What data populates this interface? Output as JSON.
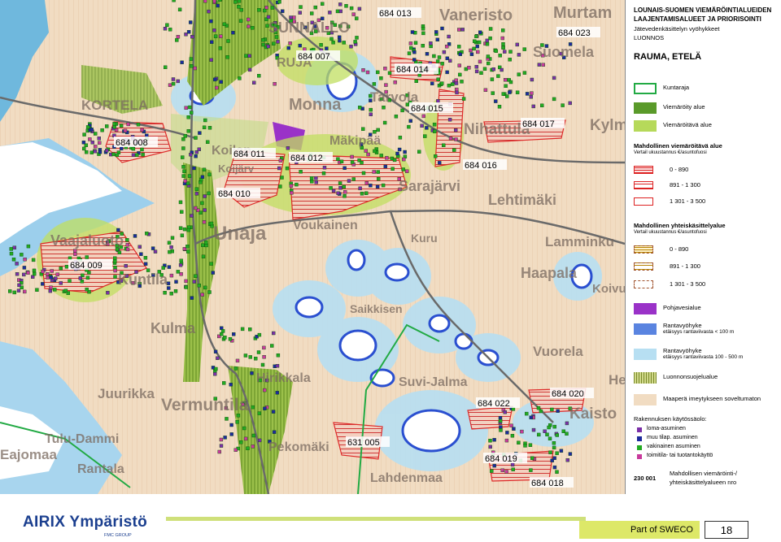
{
  "map": {
    "place_names": [
      "Vaneristo",
      "Murtam",
      "SUNNALLO",
      "Suomela",
      "RUJA",
      "Monna",
      "Tarvola",
      "KORTELA",
      "Nihattula",
      "Kylm",
      "Koilan",
      "Koijärv",
      "Mäkipää",
      "Sarajärvi",
      "Lehtimäki",
      "Unaja",
      "Voukainen",
      "Kuru",
      "Lamminku",
      "Vaajaluoto",
      "Haapala",
      "Koivu",
      "Kuntila",
      "Saikkisen",
      "Kulma",
      "Vuorela",
      "Juurikka",
      "Vermuntila",
      "Hirikkala",
      "Suvi-Jalma",
      "Pekomäki",
      "Kaisto",
      "Tulu-Dammi",
      "Eajomaa",
      "Rantala",
      "Lahdenmaa",
      "He"
    ],
    "codes": [
      "684 013",
      "684 023",
      "684 007",
      "684 014",
      "684 015",
      "684 017",
      "684 008",
      "684 011",
      "684 012",
      "684 016",
      "684 010",
      "684 009",
      "684 022",
      "684 020",
      "631 005",
      "684 019",
      "684 018"
    ]
  },
  "legend": {
    "header_line1": "LOUNAIS-SUOMEN VIEMÄRÖINTIALUEIDEN",
    "header_line2": "LAAJENTAMISALUEET JA PRIORISOINTI",
    "header_line3": "Jätevedenkäsittelyn vyöhykkeet",
    "header_line4": "LUONNOS",
    "area_title": "RAUMA, ETELÄ",
    "items_top": [
      {
        "label": "Kuntaraja",
        "color": "#22aa44"
      },
      {
        "label": "Viemäröity alue",
        "color": "#5a9a2a"
      },
      {
        "label": "Viemäröitävä alue",
        "color": "#b6d95a"
      }
    ],
    "sewer_title": "Mahdollinen viemäröitävä alue",
    "sewer_sub": "Vertail ukuustannus €/asuntofuosi",
    "sewer_ranges": [
      "0 -   890",
      "891 - 1 300",
      "1 301 - 3 500"
    ],
    "shared_title": "Mahdollinen yhteiskäsittelyalue",
    "shared_sub": "Vertail ukuustannus €/asuntofuosi",
    "shared_ranges": [
      "0 -   890",
      "891 - 1 300",
      "1 301 - 3 500"
    ],
    "items_bottom": [
      {
        "label": "Pohjavesialue",
        "sub": ""
      },
      {
        "label": "Rantavyöhyke",
        "sub": "etäisyys rantaviivasta < 100 m"
      },
      {
        "label": "Rantavyöhyke",
        "sub": "etäisyys rantaviivasta 100 - 500 m"
      },
      {
        "label": "Luonnonsuojelualue",
        "sub": ""
      },
      {
        "label": "Maaperä imeytykseen soveltumaton",
        "sub": ""
      }
    ],
    "building_title": "Rakennuksen käytössäolo:",
    "building_uses": [
      {
        "label": "loma-asuminen",
        "color": "#7b2fa8"
      },
      {
        "label": "muu tilap. asuminen",
        "color": "#1d2a9c"
      },
      {
        "label": "vakinainen asuminen",
        "color": "#22aa22"
      },
      {
        "label": "toimitila- tai tuotantokäyttö",
        "color": "#c83a9c"
      }
    ],
    "sample_code": "230 001",
    "sample_label_line1": "Mahdollisen viemäröinti-/",
    "sample_label_line2": "yhteiskäsittelyalueen nro"
  },
  "footer": {
    "logo_text": "AIRIX Ympäristö",
    "logo_sub": "FMC GROUP",
    "part_of": "Part of SWECO",
    "page_number": "18"
  }
}
